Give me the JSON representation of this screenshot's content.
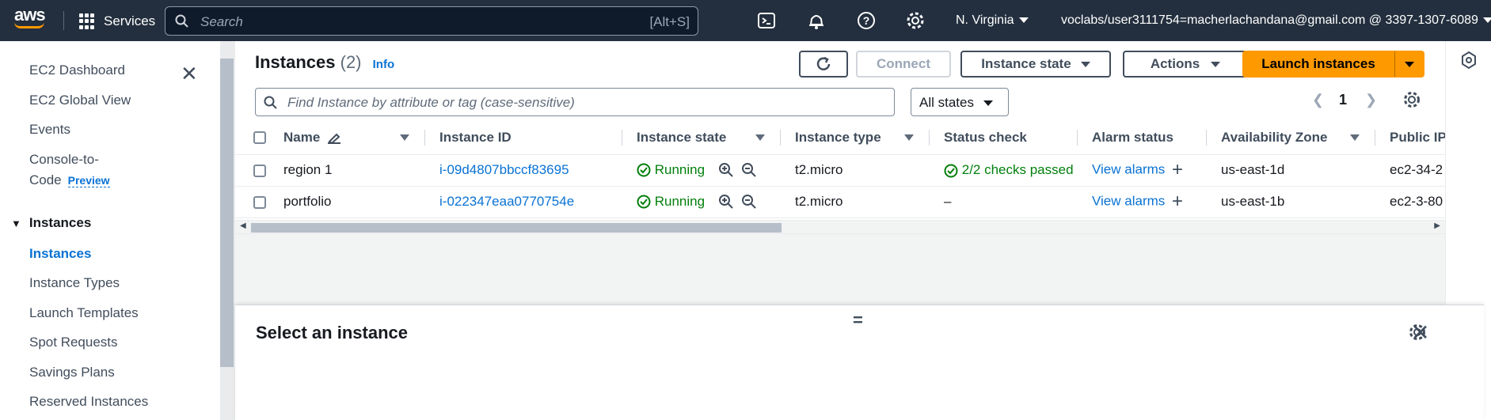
{
  "topnav": {
    "logo_text": "aws",
    "services_label": "Services",
    "search_placeholder": "Search",
    "search_shortcut": "[Alt+S]",
    "region": "N. Virginia",
    "account": "voclabs/user3111754=macherlachandana@gmail.com @ 3397-1307-6089"
  },
  "sidebar": {
    "items": [
      {
        "label": "EC2 Dashboard"
      },
      {
        "label": "EC2 Global View"
      },
      {
        "label": "Events"
      },
      {
        "label": "Console-to-",
        "label2": "Code",
        "badge": "Preview"
      },
      {
        "label": "Instances",
        "section": true
      },
      {
        "label": "Instances",
        "active": true
      },
      {
        "label": "Instance Types"
      },
      {
        "label": "Launch Templates"
      },
      {
        "label": "Spot Requests"
      },
      {
        "label": "Savings Plans"
      },
      {
        "label": "Reserved Instances"
      }
    ]
  },
  "main": {
    "title": "Instances",
    "count": "(2)",
    "info": "Info",
    "buttons": {
      "connect": "Connect",
      "instance_state": "Instance state",
      "actions": "Actions",
      "launch": "Launch instances"
    },
    "filter_placeholder": "Find Instance by attribute or tag (case-sensitive)",
    "states_filter": "All states",
    "page": "1",
    "columns": [
      "Name",
      "Instance ID",
      "Instance state",
      "Instance type",
      "Status check",
      "Alarm status",
      "Availability Zone",
      "Public IP"
    ],
    "rows": [
      {
        "name": "region 1",
        "id": "i-09d4807bbccf83695",
        "state": "Running",
        "type": "t2.micro",
        "status": "2/2 checks passed",
        "alarm": "View alarms",
        "az": "us-east-1d",
        "dns": "ec2-34-2"
      },
      {
        "name": "portfolio",
        "id": "i-022347eaa0770754e",
        "state": "Running",
        "type": "t2.micro",
        "status": "–",
        "alarm": "View alarms",
        "az": "us-east-1b",
        "dns": "ec2-3-80"
      }
    ]
  },
  "split_panel": {
    "heading": "Select an instance",
    "handle": "="
  },
  "colors": {
    "nav_bg": "#232f3e",
    "accent": "#ff9900",
    "link": "#0972d3",
    "success": "#037f0c"
  }
}
